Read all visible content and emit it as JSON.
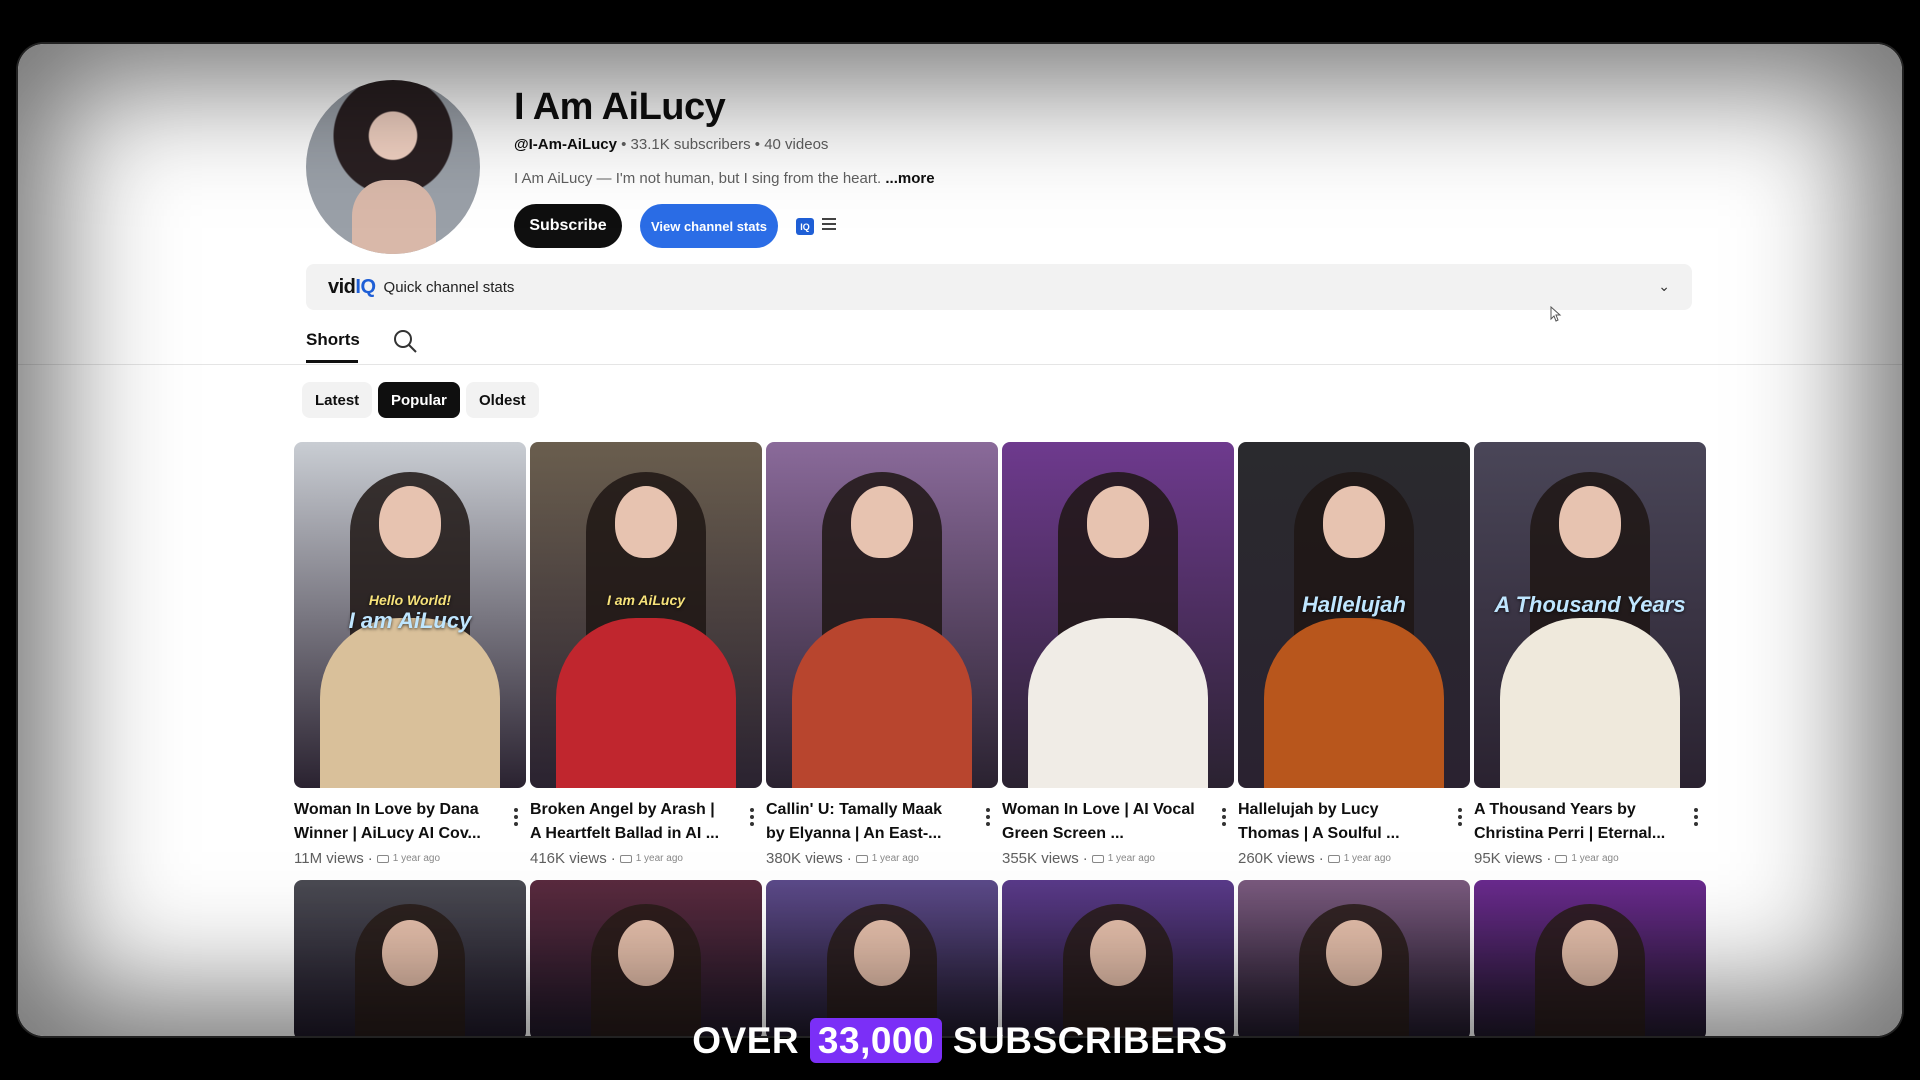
{
  "channel": {
    "title": "I Am AiLucy",
    "handle": "@I-Am-AiLucy",
    "meta_rest": " • 33.1K subscribers • 40 videos",
    "description": "I Am AiLucy — I'm not human, but I sing from the heart. ",
    "more": "...more",
    "subscribe_label": "Subscribe",
    "stats_label": "View channel stats",
    "iq_badge": "IQ"
  },
  "vidiq": {
    "logo_main": "vid",
    "logo_iq": "IQ",
    "label": "Quick channel stats"
  },
  "tabs": {
    "shorts": "Shorts"
  },
  "chips": [
    "Latest",
    "Popular",
    "Oldest"
  ],
  "active_chip": "Popular",
  "videos": [
    {
      "title": "Woman In Love by Dana Winner | AiLucy AI Cov...",
      "views": "11M views",
      "age": "1 year ago",
      "overlay_small": "Hello World!",
      "overlay_big": "I am AiLucy",
      "bg": "#c9cdd3",
      "dress": "#d9c09a"
    },
    {
      "title": "Broken Angel by Arash | A Heartfelt Ballad in AI ...",
      "views": "416K views",
      "age": "1 year ago",
      "overlay_small": "I am AiLucy",
      "overlay_big": "",
      "bg": "#6a5e4e",
      "dress": "#c0262e"
    },
    {
      "title": "Callin' U: Tamally Maak by Elyanna | An East-...",
      "views": "380K views",
      "age": "1 year ago",
      "overlay_small": "",
      "overlay_big": "",
      "bg": "#8a6a9a",
      "dress": "#b8452e"
    },
    {
      "title": "Woman In Love | AI Vocal Green Screen ...",
      "views": "355K views",
      "age": "1 year ago",
      "overlay_small": "",
      "overlay_big": "",
      "bg": "#6e3a8e",
      "dress": "#f0ece6"
    },
    {
      "title": "Hallelujah by Lucy Thomas | A Soulful ...",
      "views": "260K views",
      "age": "1 year ago",
      "overlay_small": "",
      "overlay_big": "Hallelujah",
      "bg": "#2a2a2e",
      "dress": "#b8561c"
    },
    {
      "title": "A Thousand Years by Christina Perri | Eternal...",
      "views": "95K views",
      "age": "1 year ago",
      "overlay_small": "",
      "overlay_big": "A Thousand Years",
      "bg": "#4a4658",
      "dress": "#efe9dc"
    }
  ],
  "row2_colors": [
    "#4a4a52",
    "#5a2a3e",
    "#5c4a8a",
    "#5a3a8a",
    "#7a5a7e",
    "#6a2a8e"
  ],
  "caption": {
    "pre": "OVER ",
    "highlight": "33,000",
    "post": " SUBSCRIBERS"
  }
}
